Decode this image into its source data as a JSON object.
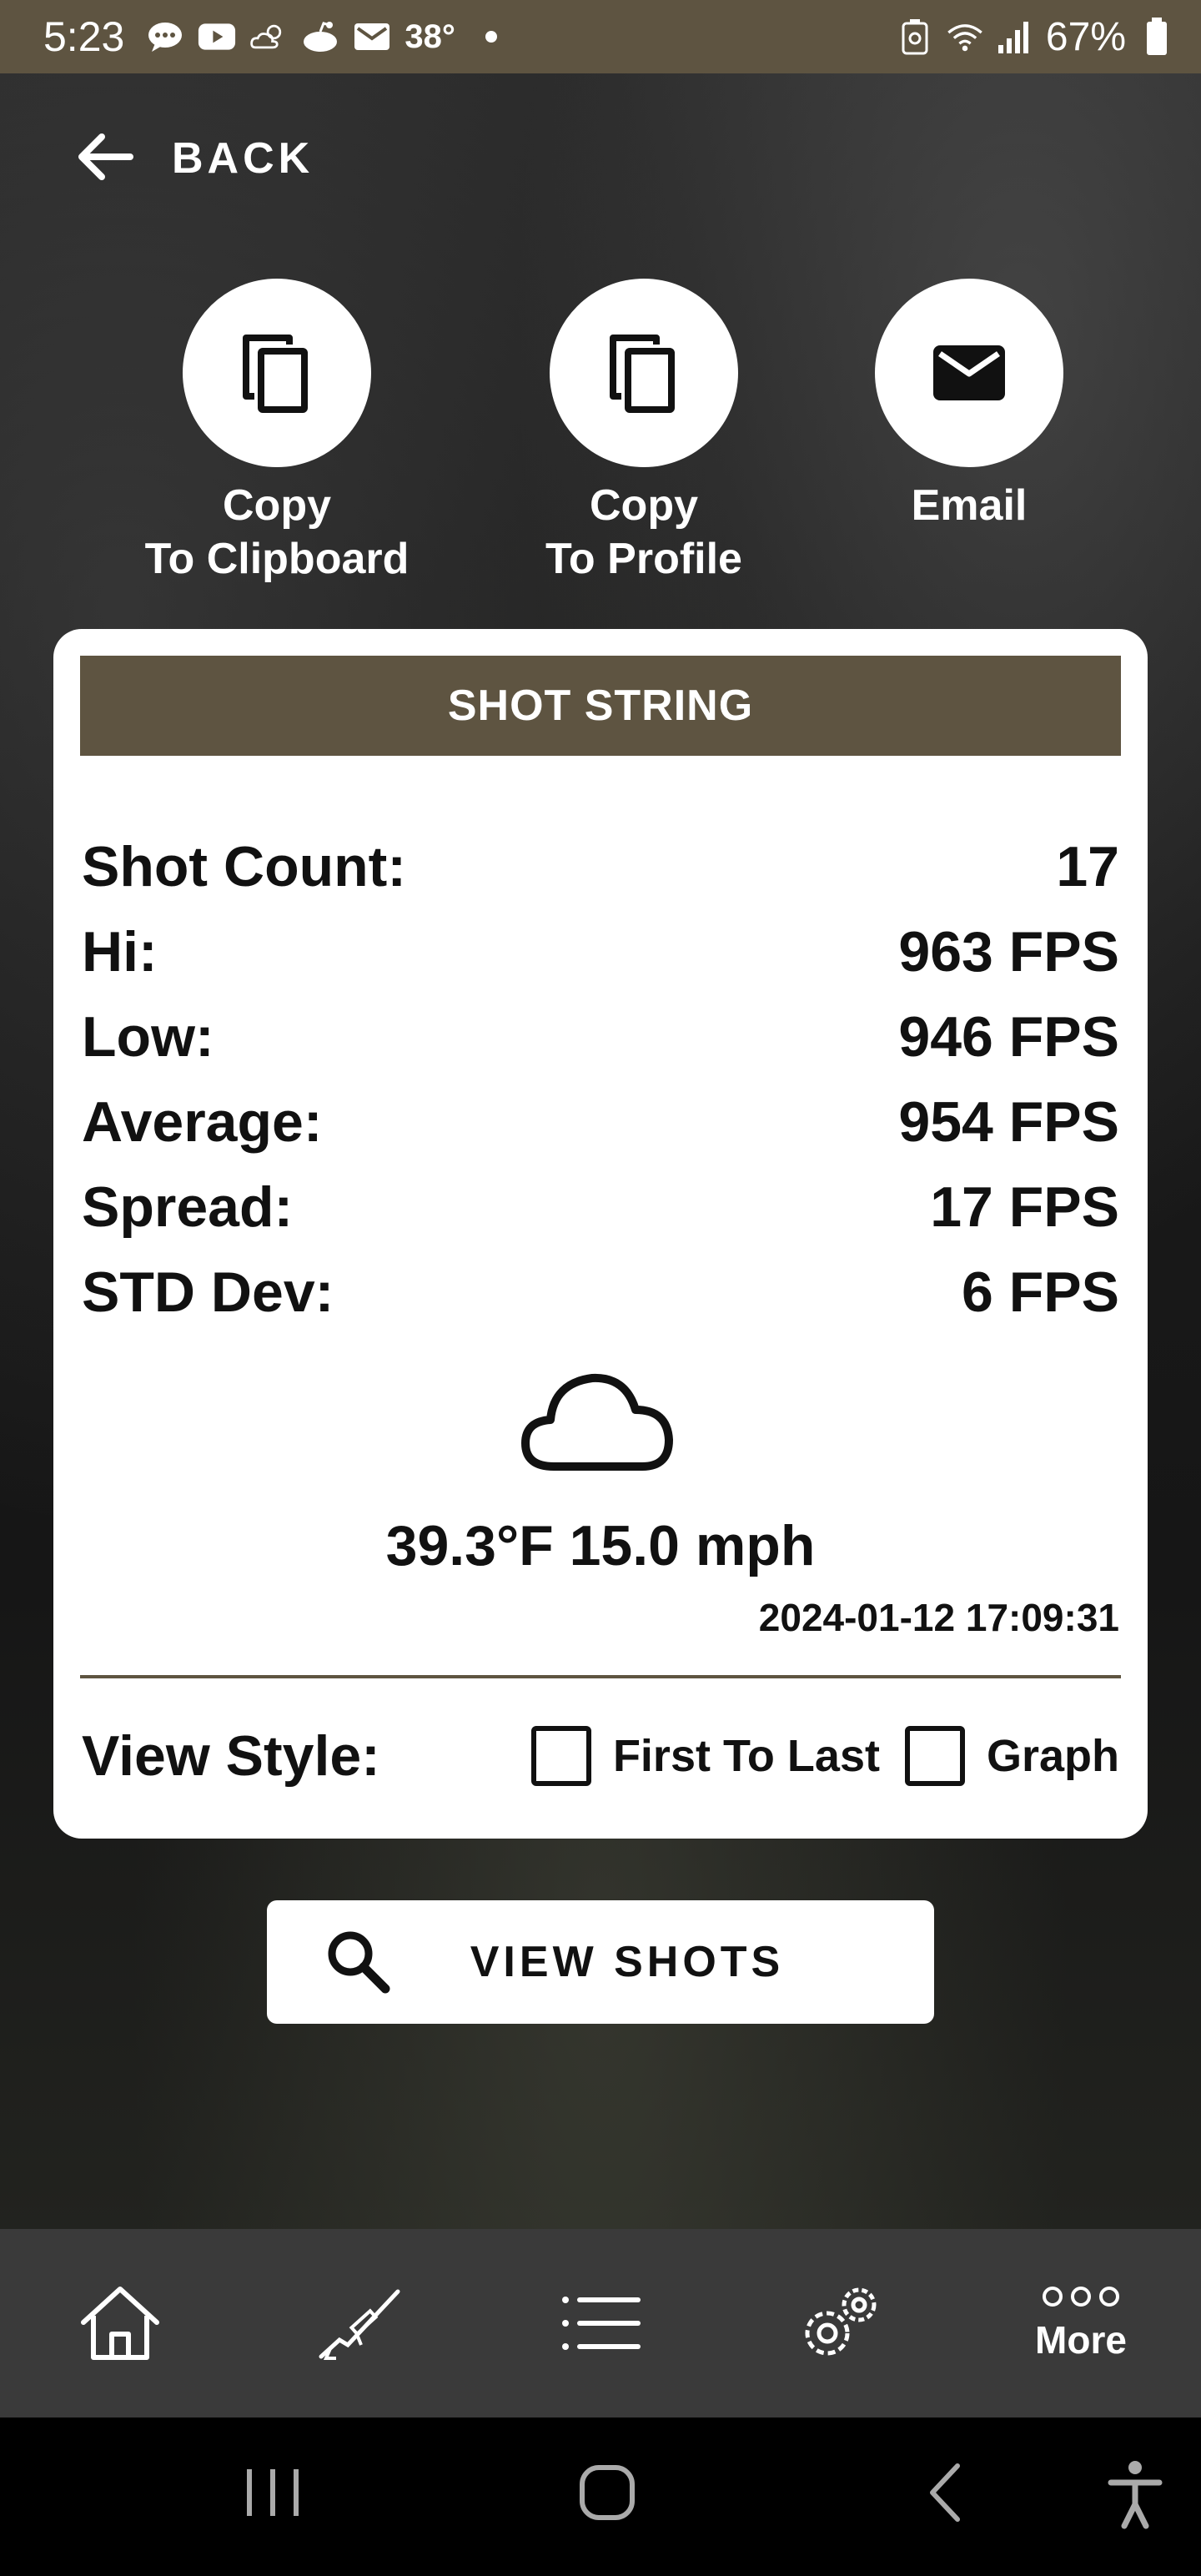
{
  "status_bar": {
    "time": "5:23",
    "temperature": "38°",
    "battery_percent": "67%"
  },
  "back_label": "BACK",
  "actions": [
    {
      "line1": "Copy",
      "line2": "To Clipboard"
    },
    {
      "line1": "Copy",
      "line2": "To Profile"
    },
    {
      "line1": "Email",
      "line2": ""
    }
  ],
  "card": {
    "header": "SHOT STRING",
    "stats": [
      {
        "label": "Shot Count:",
        "value": "17"
      },
      {
        "label": "Hi:",
        "value": "963 FPS"
      },
      {
        "label": "Low:",
        "value": "946 FPS"
      },
      {
        "label": "Average:",
        "value": "954 FPS"
      },
      {
        "label": "Spread:",
        "value": "17 FPS"
      },
      {
        "label": "STD Dev:",
        "value": "6 FPS"
      }
    ],
    "weather_icon": "cloud-icon",
    "weather": "39.3°F 15.0 mph",
    "timestamp": "2024-01-12 17:09:31",
    "view_style": {
      "label": "View Style:",
      "options": [
        {
          "label": "First To Last",
          "checked": false
        },
        {
          "label": "Graph",
          "checked": false
        }
      ]
    }
  },
  "view_shots_label": "VIEW SHOTS",
  "bottom_nav": {
    "items": [
      "home-icon",
      "rifle-icon",
      "list-icon",
      "gears-icon",
      "more-icon"
    ],
    "more_label": "More"
  },
  "colors": {
    "brand": "#5e5441",
    "nav_bg": "#3a3a3a"
  }
}
